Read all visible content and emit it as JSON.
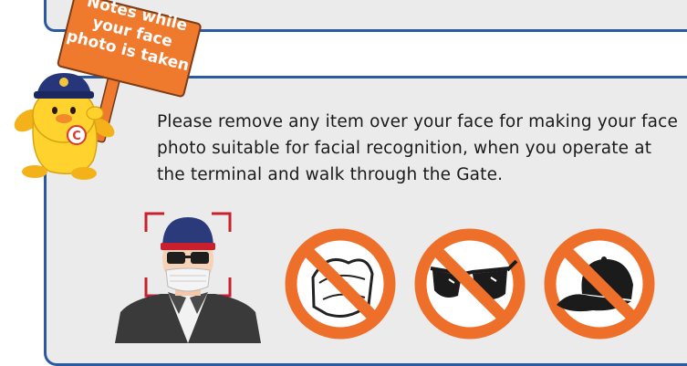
{
  "sign": {
    "lines": [
      "Notes while",
      "your face",
      "photo is taken"
    ]
  },
  "instruction": {
    "text": "Please remove any item over your face for making your face photo suitable for facial recognition, when you operate at the terminal and walk through the Gate."
  },
  "prohibited_items": [
    {
      "name": "mask",
      "icon": "no-mask-icon"
    },
    {
      "name": "sunglasses",
      "icon": "no-sunglasses-icon"
    },
    {
      "name": "cap",
      "icon": "no-cap-icon"
    }
  ],
  "colors": {
    "panel_border": "#2b5aa0",
    "panel_bg": "#ebebeb",
    "sign_orange": "#ef7a2e",
    "prohibit_orange": "#ee6f2a",
    "mascot_yellow": "#ffd22e",
    "frame_red": "#c8202f"
  }
}
